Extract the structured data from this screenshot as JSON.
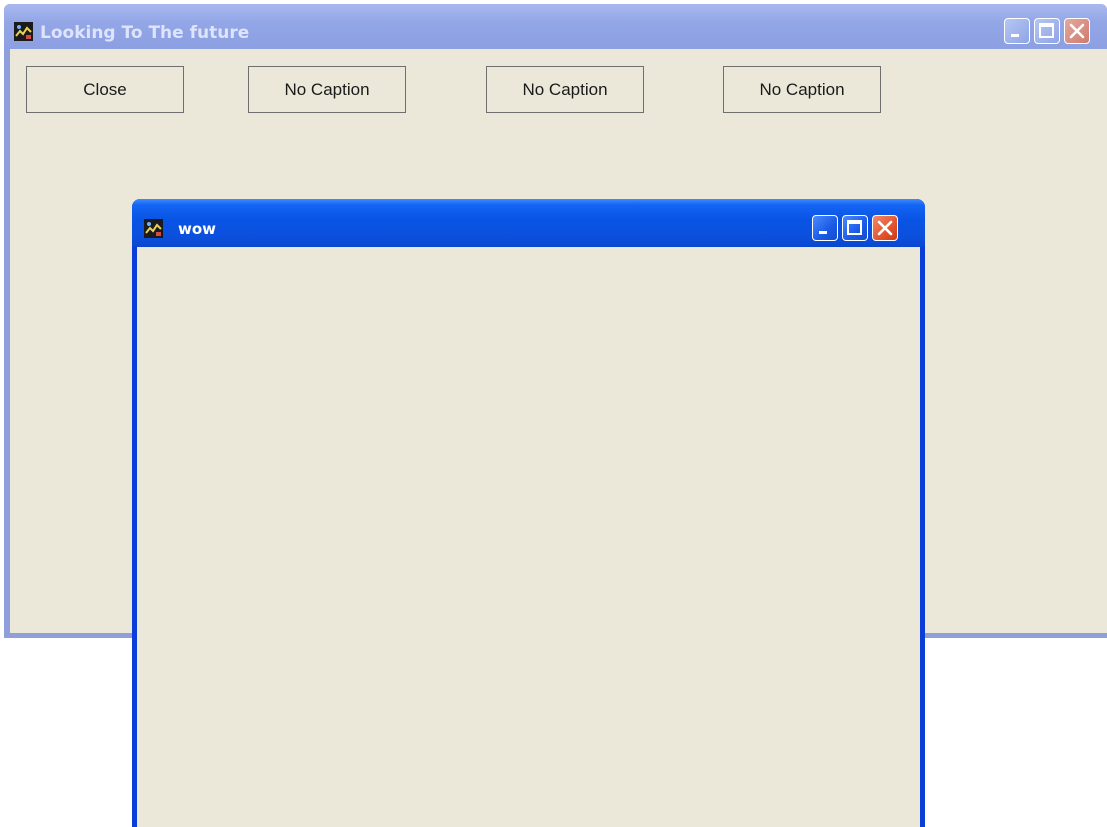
{
  "back_window": {
    "title": "Looking To The future",
    "icon": "app-icon",
    "controls": [
      "minimize-icon",
      "maximize-icon",
      "close-icon"
    ],
    "buttons": [
      {
        "label": "Close"
      },
      {
        "label": "No Caption"
      },
      {
        "label": "No Caption"
      },
      {
        "label": "No Caption"
      }
    ]
  },
  "front_window": {
    "title": "wow",
    "icon": "app-icon",
    "controls": [
      "minimize-icon",
      "maximize-icon",
      "close-icon"
    ]
  },
  "colors": {
    "client_background": "#ebe8da",
    "active_titlebar": "#0a55e6",
    "inactive_titlebar": "#93a6e6",
    "close_button_active": "#e2542e"
  }
}
